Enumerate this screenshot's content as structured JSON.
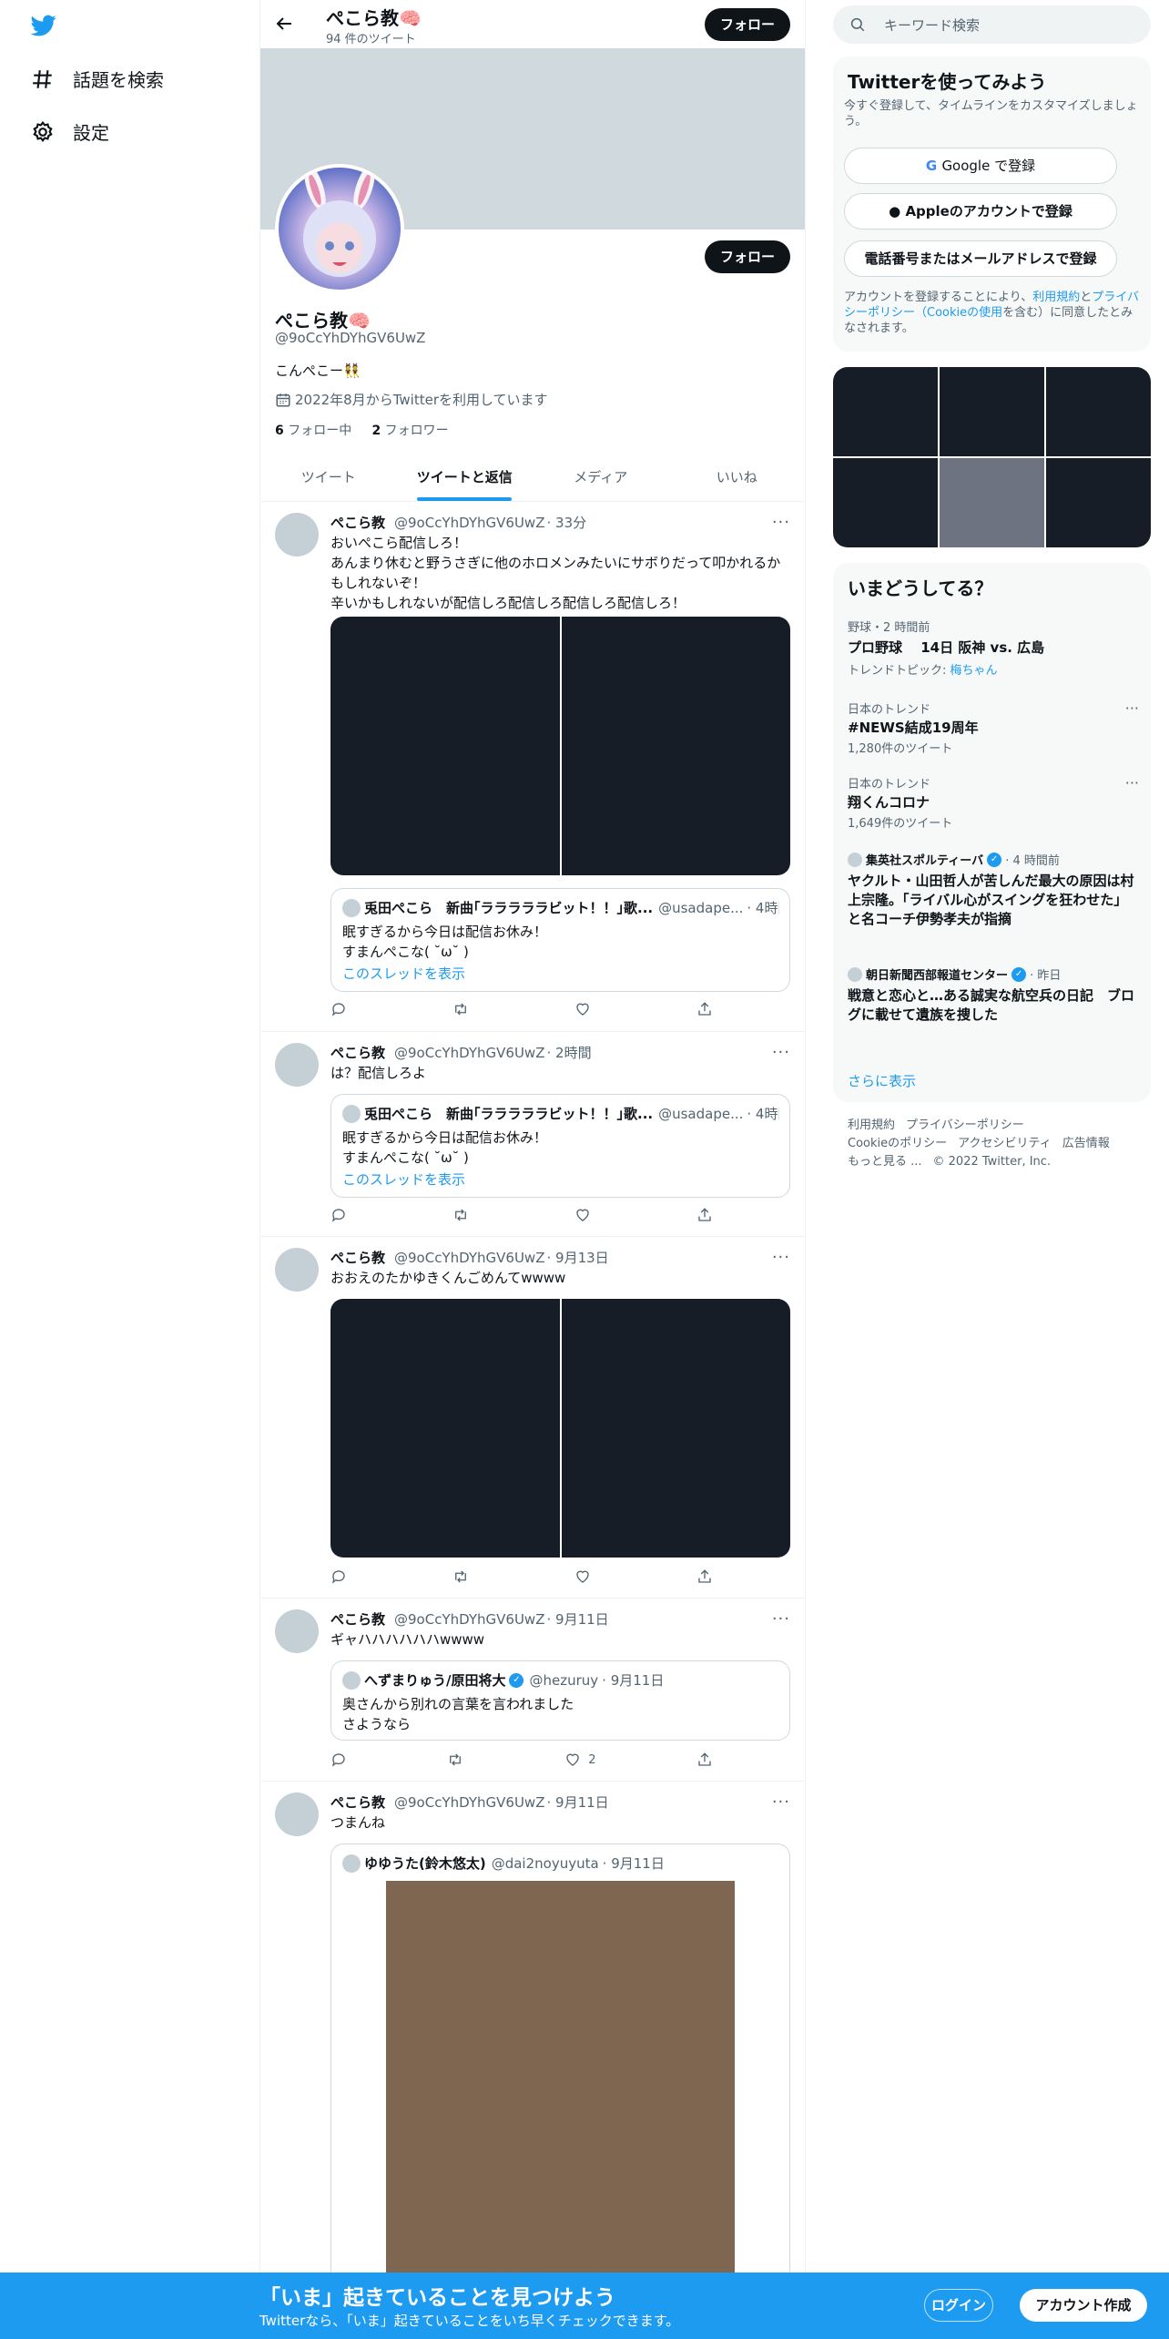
{
  "nav": {
    "explore": "話題を検索",
    "settings": "設定"
  },
  "header": {
    "name": "ぺこら教🧠",
    "tweet_count": "94 件のツイート",
    "follow": "フォロー"
  },
  "profile": {
    "follow": "フォロー",
    "name": "ぺこら教🧠",
    "handle": "@9oCcYhDYhGV6UwZ",
    "bio": "こんぺこー👯",
    "joined": "2022年8月からTwitterを利用しています",
    "following_count": "6",
    "following_label": "フォロー中",
    "followers_count": "2",
    "followers_label": "フォロワー"
  },
  "tabs": [
    "ツイート",
    "ツイートと返信",
    "メディア",
    "いいね"
  ],
  "tweets": [
    {
      "name": "ぺこら教",
      "handle": "@9oCcYhDYhGV6UwZ",
      "time": "· 33分",
      "text": "おいぺこら配信しろ！\nあんまり休むと野うさぎに他のホロメンみたいにサボりだって叩かれるかもしれないぞ！\n辛いかもしれないが配信しろ配信しろ配信しろ配信しろ！",
      "quote": {
        "name": "兎田ぺこら　新曲｢ラララララビット！！｣歌...",
        "handle": "@usadape...",
        "time": "· 4時間",
        "text": "眠すぎるから今日は配信お休み！\nすまんぺこな( ˘ω˘ )",
        "link": "このスレッドを表示"
      },
      "likes": ""
    },
    {
      "name": "ぺこら教",
      "handle": "@9oCcYhDYhGV6UwZ",
      "time": "· 2時間",
      "text": "は？配信しろよ",
      "quote": {
        "name": "兎田ぺこら　新曲｢ラララララビット！！｣歌...",
        "handle": "@usadape...",
        "time": "· 4時間",
        "text": "眠すぎるから今日は配信お休み！\nすまんぺこな( ˘ω˘ )",
        "link": "このスレッドを表示"
      },
      "likes": ""
    },
    {
      "name": "ぺこら教",
      "handle": "@9oCcYhDYhGV6UwZ",
      "time": "· 9月13日",
      "text": "おおえのたかゆきくんごめんてwwww",
      "likes": ""
    },
    {
      "name": "ぺこら教",
      "handle": "@9oCcYhDYhGV6UwZ",
      "time": "· 9月11日",
      "text": "ギャハハハハハハwwww",
      "quote": {
        "name": "へずまりゅう/原田将大",
        "handle": "@hezuruy",
        "time": "· 9月11日",
        "text": "奥さんから別れの言葉を言われました\nさようなら"
      },
      "likes": "2"
    },
    {
      "name": "ぺこら教",
      "handle": "@9oCcYhDYhGV6UwZ",
      "time": "· 9月11日",
      "text": "つまんね",
      "quote": {
        "name": "ゆゆうた(鈴木悠太)",
        "handle": "@dai2noyuyuta",
        "time": "· 9月11日"
      }
    }
  ],
  "search": {
    "placeholder": "キーワード検索"
  },
  "signup": {
    "title": "Twitterを使ってみよう",
    "subtitle": "今すぐ登録して、タイムラインをカスタマイズしましょう。",
    "google": "Google で登録",
    "apple": "Appleのアカウントで登録",
    "phone": "電話番号またはメールアドレスで登録",
    "legal_1": "アカウントを登録することにより、",
    "legal_terms": "利用規約",
    "legal_and": "と",
    "legal_privacy": "プライバシーポリシー（Cookieの使用",
    "legal_2": "を含む）に同意したとみなされます。"
  },
  "trends": {
    "title": "いまどうしてる？",
    "items": [
      {
        "meta": "野球・2 時間前",
        "name": "プロ野球　 14日 阪神 vs. 広島",
        "extra_label": "トレンドトピック: ",
        "extra_link": "梅ちゃん"
      },
      {
        "meta": "日本のトレンド",
        "name": "#NEWS結成19周年",
        "extra": "1,280件のツイート"
      },
      {
        "meta": "日本のトレンド",
        "name": "翔くんコロナ",
        "extra": "1,649件のツイート"
      }
    ],
    "news": [
      {
        "source": "集英社スポルティーバ",
        "time": "· 4 時間前",
        "title": "ヤクルト・山田哲人が苦しんだ最大の原因は村上宗隆。「ライバル心がスイングを狂わせた」と名コーチ伊勢孝夫が指摘"
      },
      {
        "source": "朝日新聞西部報道センター",
        "time": "· 昨日",
        "title": "戦意と恋心と…ある誠実な航空兵の日記　ブログに載せて遺族を捜した"
      }
    ],
    "more": "さらに表示"
  },
  "footer": {
    "terms": "利用規約",
    "privacy": "プライバシーポリシー",
    "cookie": "Cookieのポリシー",
    "accessibility": "アクセシビリティ",
    "ads": "広告情報",
    "more": "もっと見る ...",
    "copyright": "© 2022 Twitter, Inc."
  },
  "bottom_bar": {
    "title": "「いま」起きていることを見つけよう",
    "subtitle": "Twitterなら、「いま」起きていることをいち早くチェックできます。",
    "login": "ログイン",
    "signup": "アカウント作成"
  },
  "colors": {
    "accent": "#1d9bf0",
    "dark": "#0f1419",
    "muted": "#536471"
  }
}
